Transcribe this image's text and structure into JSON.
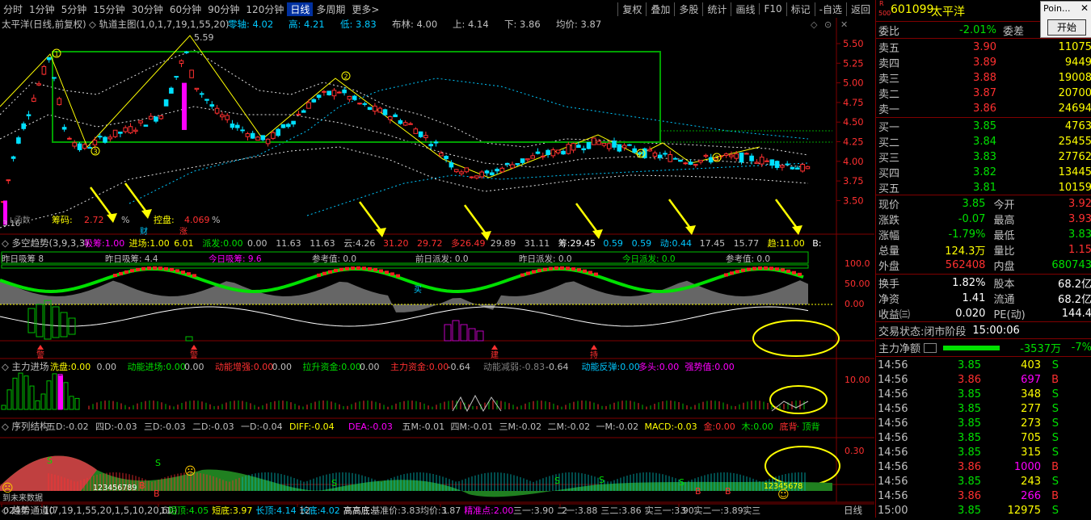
{
  "toolbar": {
    "periods": [
      "分时",
      "1分钟",
      "5分钟",
      "15分钟",
      "30分钟",
      "60分钟",
      "90分钟",
      "120分钟",
      "日线",
      "多周期",
      "更多>"
    ],
    "active_period": "日线",
    "tools": [
      "复权",
      "叠加",
      "多股",
      "统计",
      "画线",
      "F10",
      "标记",
      "-自选",
      "返回"
    ]
  },
  "main_chart": {
    "title": "太平洋(日线,前复权)",
    "indicator_name": "轨道主图(1,0,1,7,19,1,55,20)",
    "indicator_values": [
      {
        "label": "零轴:",
        "value": "4.02",
        "color": "#00c8ff"
      },
      {
        "label": "高:",
        "value": "4.21",
        "color": "#00c8ff"
      },
      {
        "label": "低:",
        "value": "3.83",
        "color": "#00c8ff"
      },
      {
        "label": "布林:",
        "value": "4.00",
        "color": "#c0c0c0"
      },
      {
        "label": "上:",
        "value": "4.14",
        "color": "#c0c0c0"
      },
      {
        "label": "下:",
        "value": "3.86",
        "color": "#c0c0c0"
      },
      {
        "label": "均价:",
        "value": "3.87",
        "color": "#c0c0c0"
      }
    ],
    "y_ticks": [
      "5.50",
      "5.25",
      "5.00",
      "4.75",
      "4.50",
      "4.25",
      "4.00",
      "3.75",
      "3.50"
    ],
    "peak_label": "5.59",
    "low_label": "3.16",
    "chip_labels": {
      "text1": "L函数",
      "chip_label": "筹码:",
      "chip_value": "2.72",
      "pct1": "%",
      "control_label": "控盘:",
      "control_value": "4.069",
      "pct2": "%",
      "cai": "财",
      "zhang": "涨"
    }
  },
  "panel2": {
    "name": "多空趋势(3,9,3,3)",
    "values": [
      {
        "label": "吸筹:",
        "value": "1.00",
        "color": "#ff00ff"
      },
      {
        "label": "进场:",
        "value": "1.00",
        "color": "#ffff00"
      },
      {
        "label": "",
        "value": "6.01",
        "color": "#ffff00"
      },
      {
        "label": "派发:",
        "value": "0.00",
        "color": "#00e000"
      },
      {
        "label": "",
        "value": "0.00",
        "color": "#c0c0c0"
      },
      {
        "label": "",
        "value": "11.63",
        "color": "#c0c0c0"
      },
      {
        "label": "",
        "value": "11.63",
        "color": "#c0c0c0"
      },
      {
        "label": "云:",
        "value": "4.26",
        "color": "#c0c0c0"
      },
      {
        "label": "",
        "value": "31.20",
        "color": "#ff3030"
      },
      {
        "label": "",
        "value": "29.72",
        "color": "#ff3030"
      },
      {
        "label": "多",
        "value": "26.49",
        "color": "#ff3030"
      },
      {
        "label": "",
        "value": "29.89",
        "color": "#c0c0c0"
      },
      {
        "label": "",
        "value": "31.11",
        "color": "#c0c0c0"
      },
      {
        "label": "筹:",
        "value": "29.45",
        "color": "#ffffff"
      },
      {
        "label": "",
        "value": "0.59",
        "color": "#00c8ff"
      },
      {
        "label": "",
        "value": "0.59",
        "color": "#00c8ff"
      },
      {
        "label": "动:",
        "value": "0.44",
        "color": "#00c8ff"
      },
      {
        "label": "",
        "value": "17.45",
        "color": "#c0c0c0"
      },
      {
        "label": "",
        "value": "15.77",
        "color": "#c0c0c0"
      },
      {
        "label": "趋:",
        "value": "11.00",
        "color": "#ffff00"
      },
      {
        "label": "B:",
        "value": "",
        "color": "#ffffff"
      }
    ],
    "sub_labels": [
      {
        "text": "昨日吸筹",
        "value": "8",
        "color": "#c0c0c0"
      },
      {
        "text": "昨日吸筹:",
        "value": "4.4",
        "color": "#c0c0c0"
      },
      {
        "text": "今日吸筹:",
        "value": "9.6",
        "color": "#ff00ff"
      },
      {
        "text": "参考值:",
        "value": "0.0",
        "color": "#c0c0c0"
      },
      {
        "text": "前日派发:",
        "value": "0.0",
        "color": "#c0c0c0"
      },
      {
        "text": "昨日派发:",
        "value": "0.0",
        "color": "#c0c0c0"
      },
      {
        "text": "今日派发:",
        "value": "0.0",
        "color": "#00e000"
      },
      {
        "text": "参考值:",
        "value": "0.0",
        "color": "#c0c0c0"
      }
    ],
    "y_ticks": [
      "100.0",
      "50.00",
      "0.00"
    ],
    "markers": [
      "警",
      "警",
      "建",
      "持",
      "买"
    ]
  },
  "panel3": {
    "name": "主力进场",
    "values": [
      {
        "label": "洗盘:",
        "value": "0.00",
        "color": "#ffff00"
      },
      {
        "label": "",
        "value": "0.00",
        "color": "#c0c0c0"
      },
      {
        "label": "动能进场:",
        "value": "0.00",
        "color": "#00e000"
      },
      {
        "label": "",
        "value": "0.00",
        "color": "#c0c0c0"
      },
      {
        "label": "动能增强:",
        "value": "0.00",
        "color": "#ff3030"
      },
      {
        "label": "",
        "value": "0.00",
        "color": "#c0c0c0"
      },
      {
        "label": "拉升资金:",
        "value": "0.00",
        "color": "#00e000"
      },
      {
        "label": "",
        "value": "0.00",
        "color": "#c0c0c0"
      },
      {
        "label": "主力资金:",
        "value": "0.00",
        "color": "#ff3030"
      },
      {
        "label": "",
        "value": "-0.64",
        "color": "#c0c0c0"
      },
      {
        "label": "动能减弱:",
        "value": "-0.83",
        "color": "#808080"
      },
      {
        "label": "",
        "value": "-0.64",
        "color": "#c0c0c0"
      },
      {
        "label": "动能反弹:",
        "value": "0.00",
        "color": "#00c8ff"
      },
      {
        "label": "多头:",
        "value": "0.00",
        "color": "#ff00ff"
      },
      {
        "label": "强势值:",
        "value": "0.00",
        "color": "#ff00ff"
      }
    ],
    "y_tick": "10.00"
  },
  "panel4": {
    "name": "序列结构",
    "values": [
      {
        "label": "五D:",
        "value": "-0.02",
        "color": "#c0c0c0"
      },
      {
        "label": "四D:",
        "value": "-0.03",
        "color": "#c0c0c0"
      },
      {
        "label": "三D:",
        "value": "-0.03",
        "color": "#c0c0c0"
      },
      {
        "label": "二D:",
        "value": "-0.03",
        "color": "#c0c0c0"
      },
      {
        "label": "一D:",
        "value": "-0.04",
        "color": "#c0c0c0"
      },
      {
        "label": "DIFF:",
        "value": "-0.04",
        "color": "#ffff00"
      },
      {
        "label": "DEA:",
        "value": "-0.03",
        "color": "#ff00ff"
      },
      {
        "label": "五M:",
        "value": "-0.01",
        "color": "#c0c0c0"
      },
      {
        "label": "四M:",
        "value": "-0.01",
        "color": "#c0c0c0"
      },
      {
        "label": "三M:",
        "value": "-0.02",
        "color": "#c0c0c0"
      },
      {
        "label": "二M:",
        "value": "-0.02",
        "color": "#c0c0c0"
      },
      {
        "label": "一M:",
        "value": "-0.02",
        "color": "#c0c0c0"
      },
      {
        "label": "MACD:",
        "value": "-0.03",
        "color": "#ffff00"
      },
      {
        "label": "金:",
        "value": "0.00",
        "color": "#ff3030"
      },
      {
        "label": "木:",
        "value": "0.00",
        "color": "#00e000"
      },
      {
        "label": "底背",
        "value": "",
        "color": "#ff3030"
      },
      {
        "label": "· 顶背",
        "value": "",
        "color": "#00e000"
      }
    ],
    "y_tick": "0.30",
    "seq_text": "123456789",
    "future_label": "到未来数据"
  },
  "panel5": {
    "name": "趋势通道(7,19,1,55,20,1,5,10,20,60)",
    "values": [
      {
        "label": "短顶:",
        "value": "4.05",
        "color": "#00e000"
      },
      {
        "label": "短底:",
        "value": "3.97",
        "color": "#ffff00"
      },
      {
        "label": "长顶:",
        "value": "4.14",
        "color": "#00c8ff"
      },
      {
        "label": "长底:",
        "value": "4.02",
        "color": "#00c8ff"
      },
      {
        "label": "高高底:",
        "value": "",
        "color": "#ffffff"
      },
      {
        "label": "基准价:",
        "value": "3.83",
        "color": "#c0c0c0"
      },
      {
        "label": "均价:",
        "value": "3.87",
        "color": "#c0c0c0"
      },
      {
        "label": "精准点:",
        "value": "2.00",
        "color": "#ff00ff"
      },
      {
        "label": "三一:",
        "value": "3.90",
        "color": "#c0c0c0"
      },
      {
        "label": "二一:",
        "value": "3.88",
        "color": "#c0c0c0"
      },
      {
        "label": "三二:",
        "value": "3.86",
        "color": "#c0c0c0"
      },
      {
        "label": "实三一:",
        "value": "3.90",
        "color": "#c0c0c0"
      },
      {
        "label": "实二一:",
        "value": "3.89",
        "color": "#c0c0c0"
      },
      {
        "label": "实三",
        "value": "",
        "color": "#c0c0c0"
      }
    ]
  },
  "xaxis": {
    "labels": [
      "024年",
      "10",
      "11",
      "12",
      "1",
      "2",
      "3"
    ],
    "period_label": "日线"
  },
  "right_panel": {
    "code": "601099",
    "name": "太平洋",
    "weibi_label": "委比",
    "weibi": "-2.01%",
    "weicha_label": "委差",
    "weicha": "-",
    "asks": [
      {
        "label": "卖五",
        "price": "3.90",
        "vol": "11075"
      },
      {
        "label": "卖四",
        "price": "3.89",
        "vol": "9449"
      },
      {
        "label": "卖三",
        "price": "3.88",
        "vol": "19008"
      },
      {
        "label": "卖二",
        "price": "3.87",
        "vol": "20700"
      },
      {
        "label": "卖一",
        "price": "3.86",
        "vol": "24694"
      }
    ],
    "bids": [
      {
        "label": "买一",
        "price": "3.85",
        "vol": "4763"
      },
      {
        "label": "买二",
        "price": "3.84",
        "vol": "25455"
      },
      {
        "label": "买三",
        "price": "3.83",
        "vol": "27762"
      },
      {
        "label": "买四",
        "price": "3.82",
        "vol": "13445"
      },
      {
        "label": "买五",
        "price": "3.81",
        "vol": "10159"
      }
    ],
    "stats": [
      {
        "l1": "现价",
        "v1": "3.85",
        "c1": "#00e000",
        "l2": "今开",
        "v2": "3.92",
        "c2": "#ff3030"
      },
      {
        "l1": "涨跌",
        "v1": "-0.07",
        "c1": "#00e000",
        "l2": "最高",
        "v2": "3.93",
        "c2": "#ff3030"
      },
      {
        "l1": "涨幅",
        "v1": "-1.79%",
        "c1": "#00e000",
        "l2": "最低",
        "v2": "3.83",
        "c2": "#00e000"
      },
      {
        "l1": "总量",
        "v1": "124.3万",
        "c1": "#ffff00",
        "l2": "量比",
        "v2": "1.15",
        "c2": "#ff3030"
      },
      {
        "l1": "外盘",
        "v1": "562408",
        "c1": "#ff3030",
        "l2": "内盘",
        "v2": "680743",
        "c2": "#00e000"
      }
    ],
    "stats2": [
      {
        "l1": "换手",
        "v1": "1.82%",
        "l2": "股本",
        "v2": "68.2亿"
      },
      {
        "l1": "净资",
        "v1": "1.41",
        "l2": "流通",
        "v2": "68.2亿"
      },
      {
        "l1": "收益㈢",
        "v1": "0.020",
        "l2": "PE(动)",
        "v2": "144.4"
      }
    ],
    "trade_status_label": "交易状态:",
    "trade_status": "闭市阶段",
    "trade_time": "15:00:06",
    "main_net_label": "主力净额",
    "main_net_value": "-3537万",
    "main_net_pct": "-7%",
    "ticks": [
      {
        "t": "14:56",
        "p": "3.85",
        "v": "403",
        "bs": "S"
      },
      {
        "t": "14:56",
        "p": "3.86",
        "v": "697",
        "bs": "B"
      },
      {
        "t": "14:56",
        "p": "3.85",
        "v": "348",
        "bs": "S"
      },
      {
        "t": "14:56",
        "p": "3.85",
        "v": "277",
        "bs": "S"
      },
      {
        "t": "14:56",
        "p": "3.85",
        "v": "273",
        "bs": "S"
      },
      {
        "t": "14:56",
        "p": "3.85",
        "v": "705",
        "bs": "S"
      },
      {
        "t": "14:56",
        "p": "3.85",
        "v": "315",
        "bs": "S"
      },
      {
        "t": "14:56",
        "p": "3.86",
        "v": "1000",
        "bs": "B"
      },
      {
        "t": "14:56",
        "p": "3.85",
        "v": "243",
        "bs": "S"
      },
      {
        "t": "14:56",
        "p": "3.86",
        "v": "266",
        "bs": "B"
      },
      {
        "t": "15:00",
        "p": "3.85",
        "v": "12975",
        "bs": "S"
      }
    ]
  },
  "popup": {
    "title": "Poin...",
    "button": "开始"
  }
}
